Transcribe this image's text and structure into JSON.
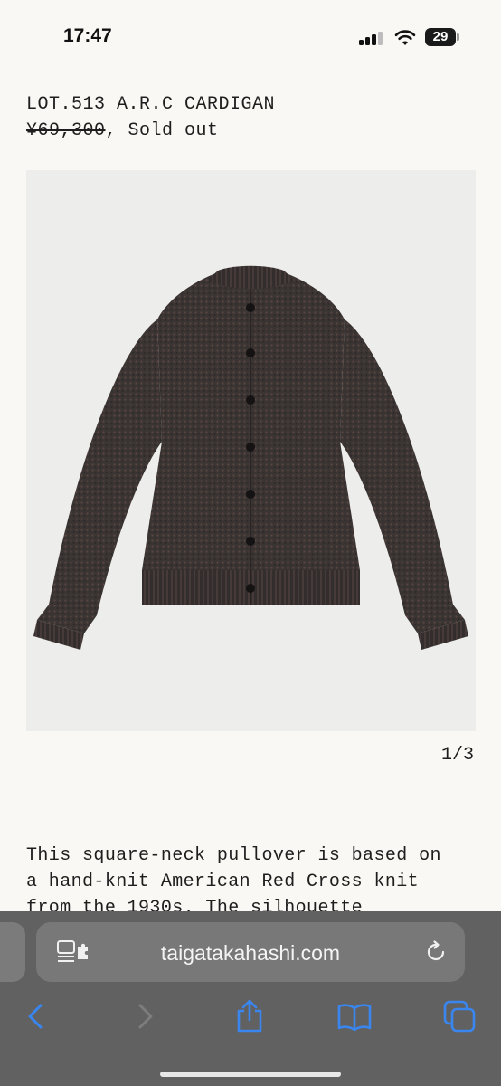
{
  "status_bar": {
    "time": "17:47",
    "battery": "29"
  },
  "product": {
    "title": "LOT.513 A.R.C CARDIGAN",
    "price": "¥69,300",
    "separator": ",",
    "availability": "Sold out",
    "image_counter": "1/3",
    "description": "This square-neck pullover is based on\na hand-knit American Red Cross knit\nfrom the 1930s. The silhouette"
  },
  "browser": {
    "url": "taigatakahashi.com",
    "accent_color": "#3a86f0"
  },
  "icons": {
    "page_menu": "page-menu-icon",
    "reload": "reload-icon",
    "back": "chevron-left-icon",
    "forward": "chevron-right-icon",
    "share": "share-icon",
    "bookmarks": "book-icon",
    "tabs": "tabs-icon"
  }
}
